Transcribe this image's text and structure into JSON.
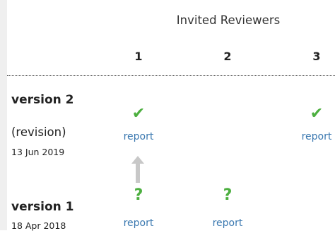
{
  "header": {
    "title": "Invited Reviewers",
    "columns": [
      "1",
      "2",
      "3"
    ]
  },
  "versions": [
    {
      "title": "version 2",
      "note": "(revision)",
      "date": "13 Jun 2019",
      "reviews": [
        {
          "status": "approved",
          "icon": "check-icon",
          "glyph": "✔",
          "link": "report"
        },
        {
          "status": "none"
        },
        {
          "status": "approved",
          "icon": "check-icon",
          "glyph": "✔",
          "link": "report"
        }
      ]
    },
    {
      "title": "version 1",
      "date": "18 Apr 2018",
      "reviews": [
        {
          "status": "approved-with-reservations",
          "icon": "question-icon",
          "glyph": "?",
          "link": "report"
        },
        {
          "status": "approved-with-reservations",
          "icon": "question-icon",
          "glyph": "?",
          "link": "report"
        },
        {
          "status": "none"
        }
      ]
    }
  ],
  "colors": {
    "status_green": "#4caf3f",
    "link_blue": "#3a78b0",
    "arrow_gray": "#c8c8c8"
  }
}
